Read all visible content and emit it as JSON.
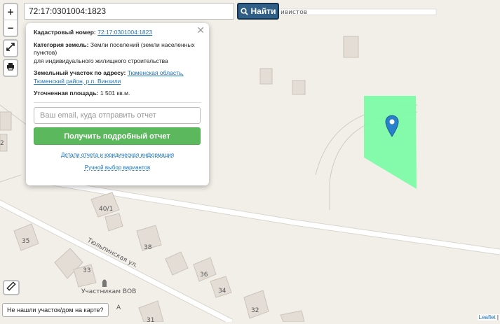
{
  "search": {
    "value": "72:17:0301004:1823",
    "button_label": "Найти"
  },
  "controls": {
    "zoom_in": "+",
    "zoom_out": "−"
  },
  "popup": {
    "cadastral_label": "Кадастровый номер:",
    "cadastral_value": "72:17:0301004:1823",
    "category_label": "Категория земель:",
    "category_value": "Земли поселений (земли населенных пунктов)",
    "category_use": "для индивидуального жилищного строительства",
    "address_label": "Земельный участок по адресу:",
    "address_line1": "Тюменская область,",
    "address_line2": "Тюменский район, р.п. Винзили",
    "area_label": "Уточненная площадь:",
    "area_value": "1 501 кв.м.",
    "email_placeholder": "Ваш email, куда отправить отчет",
    "report_button": "Получить подробный отчет",
    "details_link": "Детали отчета и юридическая информация",
    "manual_link": "Ручной выбор вариантов"
  },
  "map": {
    "street_top": "ивистов",
    "street_main": "Тюльпинская ул.",
    "poi_label": "Участникам ВОВ",
    "house_numbers": [
      "40/1",
      "35",
      "38",
      "33",
      "36",
      "34",
      "32",
      "31",
      "2",
      "A"
    ],
    "parcel_color": "#7dfba6"
  },
  "footer": {
    "not_found": "Не нашли участок/дом на карте?",
    "attribution": "Leaflet",
    "sep": "|"
  }
}
